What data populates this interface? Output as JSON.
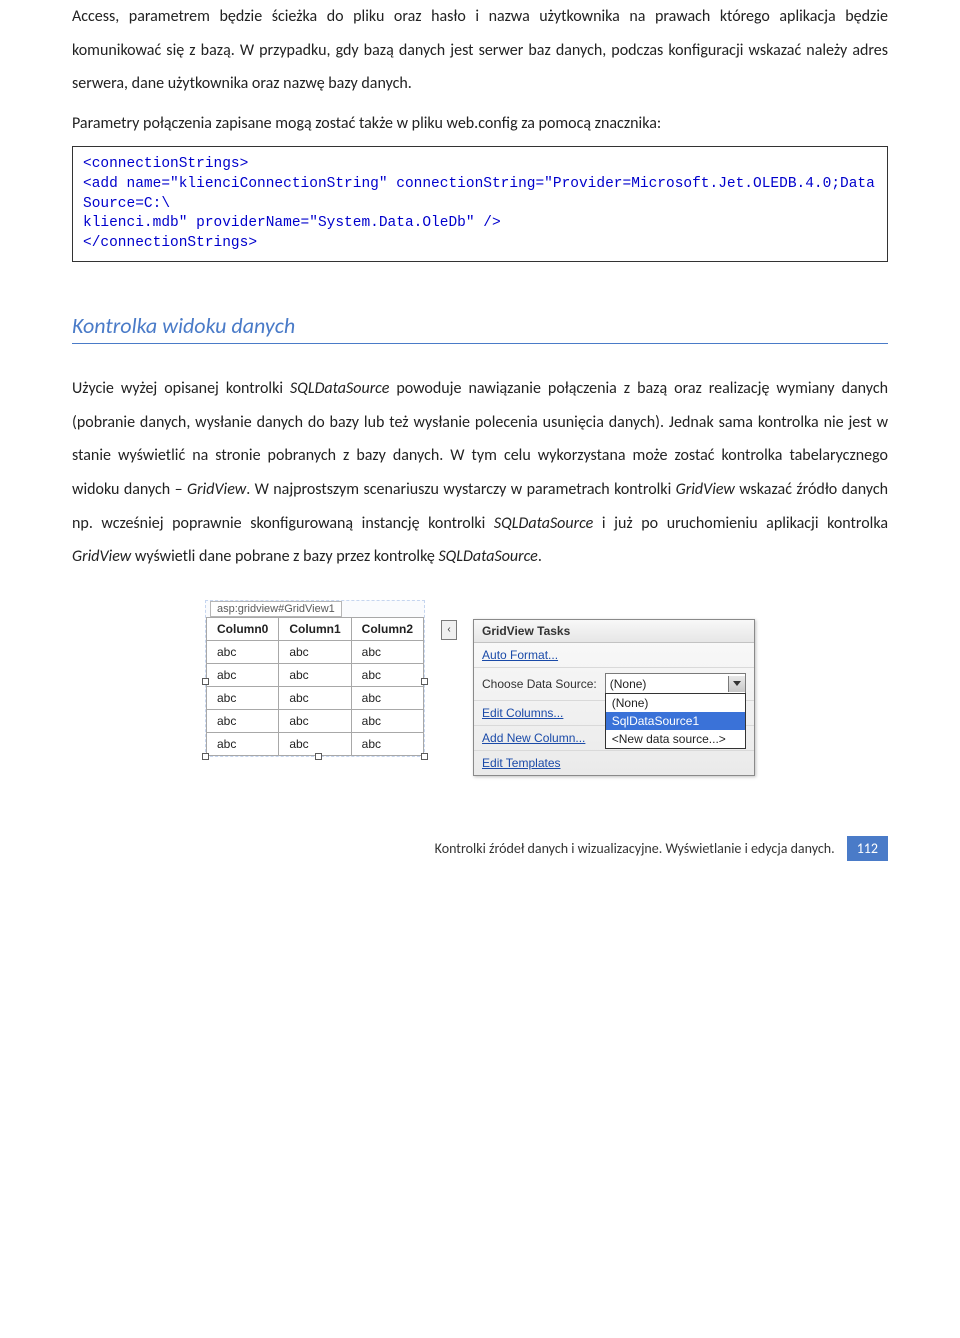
{
  "para1": "Access, parametrem będzie ścieżka do pliku oraz  hasło i nazwa użytkownika na prawach którego aplikacja będzie komunikować się z bazą.  W przypadku, gdy bazą danych jest serwer baz danych, podczas konfiguracji wskazać należy adres serwera,  dane użytkownika oraz nazwę bazy danych.",
  "para2": "Parametry połączenia zapisane mogą zostać także w pliku web.config za pomocą znacznika:",
  "code": "<connectionStrings>\n<add name=\"klienciConnectionString\" connectionString=\"Provider=Microsoft.Jet.OLEDB.4.0;Data Source=C:\\\nklienci.mdb\" providerName=\"System.Data.OleDb\" />\n</connectionStrings>",
  "heading": "Kontrolka widoku danych",
  "para3_part1": "Użycie wyżej opisanej kontrolki ",
  "para3_em1": "SQLDataSource",
  "para3_part2": " powoduje nawiązanie połączenia z bazą oraz realizację wymiany danych (pobranie danych, wysłanie danych do bazy lub też wysłanie polecenia usunięcia danych).  Jednak sama kontrolka nie jest w stanie wyświetlić na stronie pobranych z bazy danych. W tym celu wykorzystana może zostać kontrolka tabelarycznego widoku danych – ",
  "para3_em2": "GridView",
  "para3_part3": ".   W najprostszym scenariuszu wystarczy w parametrach kontrolki ",
  "para3_em3": "GridView",
  "para3_part4": " wskazać źródło danych np. wcześniej poprawnie skonfigurowaną instancję kontrolki ",
  "para3_em4": "SQLDataSource",
  "para3_part5": " i już po uruchomieniu aplikacji kontrolka ",
  "para3_em5": "GridView",
  "para3_part6": " wyświetli dane pobrane z bazy przez kontrolkę ",
  "para3_em6": "SQLDataSource",
  "para3_part7": ".",
  "gridview": {
    "tag": "asp:gridview#GridView1",
    "headers": [
      "Column0",
      "Column1",
      "Column2"
    ],
    "cell": "abc",
    "rows": 5
  },
  "smartTag": {
    "title": "GridView Tasks",
    "autoFormat": "Auto Format...",
    "chooseLabel": "Choose Data Source:",
    "selected": "(None)",
    "options": [
      "(None)",
      "SqlDataSource1",
      "<New data source...>"
    ],
    "selectedIndex": 1,
    "editColumns": "Edit Columns...",
    "addNewColumn": "Add New Column...",
    "editTemplates": "Edit Templates"
  },
  "footer": {
    "text": "Kontrolki źródeł danych i wizualizacyjne.  Wyświetlanie i edycja danych.",
    "page": "112"
  }
}
